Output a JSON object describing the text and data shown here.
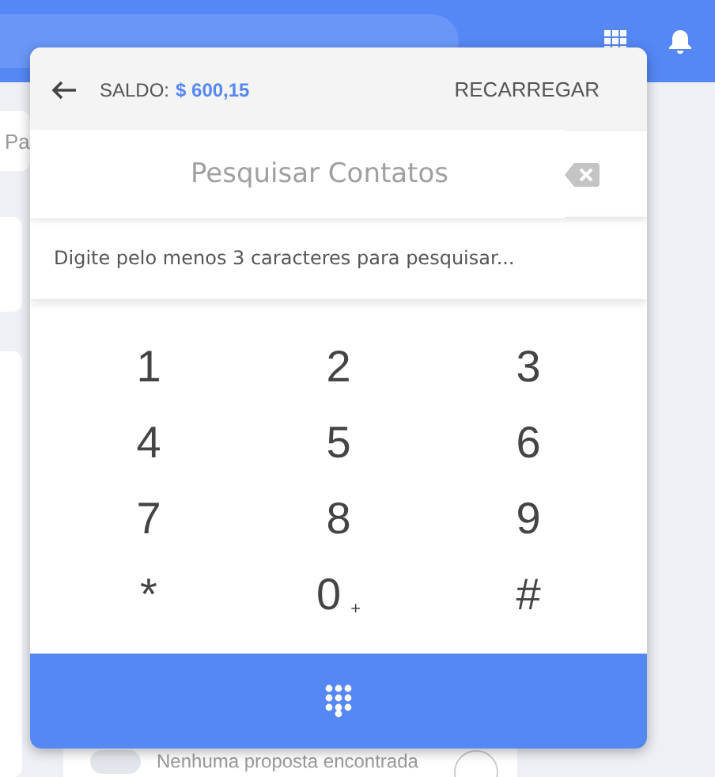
{
  "background": {
    "search_partial": "Pa",
    "empty_message": "Nenhuma proposta encontrada",
    "toggle": {
      "on": false
    }
  },
  "dialer": {
    "balance_label": "SALDO:",
    "balance": "$ 600,15",
    "recharge": "RECARREGAR",
    "search": {
      "placeholder": "Pesquisar Contatos"
    },
    "hint": "Digite pelo menos 3 caracteres para pesquisar...",
    "keys": [
      {
        "digit": "1"
      },
      {
        "digit": "2"
      },
      {
        "digit": "3"
      },
      {
        "digit": "4"
      },
      {
        "digit": "5"
      },
      {
        "digit": "6"
      },
      {
        "digit": "7"
      },
      {
        "digit": "8"
      },
      {
        "digit": "9"
      },
      {
        "digit": "*"
      },
      {
        "digit": "0",
        "sub": "+"
      },
      {
        "digit": "#"
      }
    ]
  }
}
